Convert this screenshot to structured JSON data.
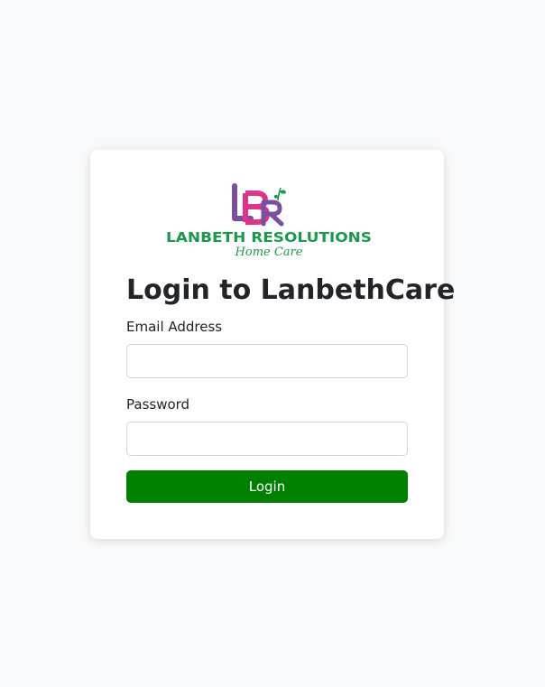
{
  "logo": {
    "monogram": "LBR",
    "company_name": "LANBETH RESOLUTIONS",
    "tagline": "Home Care",
    "colors": {
      "purple": "#7b4fa0",
      "magenta": "#e0348a",
      "green": "#1a9a4a"
    }
  },
  "login": {
    "title": "Login to LanbethCare",
    "email_label": "Email Address",
    "email_value": "",
    "password_label": "Password",
    "password_value": "",
    "submit_label": "Login"
  },
  "theme": {
    "page_background": "#f8f9fa",
    "button_color": "#008000"
  }
}
